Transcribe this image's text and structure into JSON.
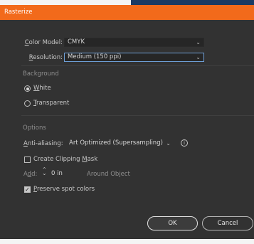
{
  "window": {
    "title": "Rasterize"
  },
  "color_model": {
    "label": "Color Model:",
    "value": "CMYK"
  },
  "resolution": {
    "label": "Resolution:",
    "value": "Medium (150 ppi)"
  },
  "background": {
    "heading": "Background",
    "white_label": "White",
    "transparent_label": "Transparent",
    "selected": "White"
  },
  "options": {
    "heading": "Options",
    "antialiasing_label": "Anti-aliasing:",
    "antialiasing_value": "Art Optimized (Supersampling)",
    "clipping_mask_label": "Create Clipping Mask",
    "clipping_mask_checked": false,
    "add_label": "Add:",
    "add_value": "0 in",
    "around_object_label": "Around Object",
    "preserve_spot_label": "Preserve spot colors",
    "preserve_spot_checked": true
  },
  "buttons": {
    "ok": "OK",
    "cancel": "Cancel"
  },
  "icons": {
    "chevron": "chevron-down-icon",
    "info": "info-icon",
    "spinner": "spinner-icon"
  }
}
